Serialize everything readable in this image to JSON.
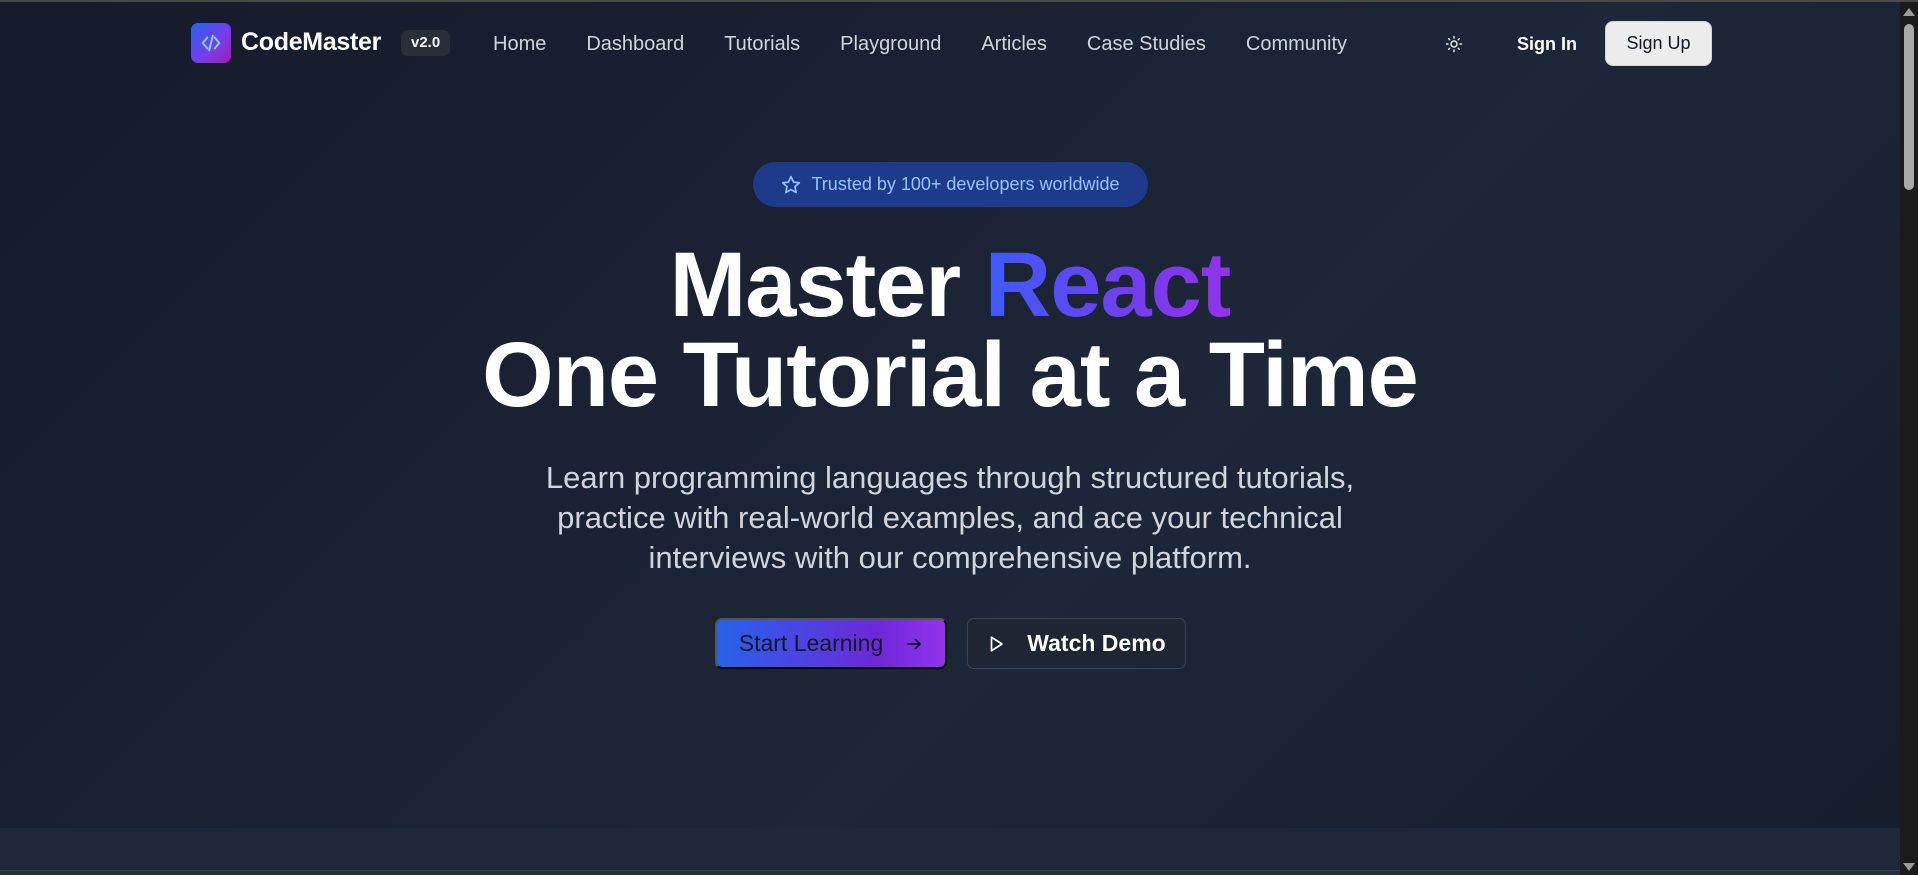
{
  "header": {
    "brand_name": "CodeMaster",
    "version_badge": "v2.0",
    "nav_links": [
      "Home",
      "Dashboard",
      "Tutorials",
      "Playground",
      "Articles",
      "Case Studies",
      "Community"
    ],
    "sign_in_label": "Sign In",
    "sign_up_label": "Sign Up"
  },
  "hero": {
    "trust_badge": "Trusted by 100+ developers worldwide",
    "headline_line1_prefix": "Master",
    "headline_line1_accent": "React",
    "headline_line2": "One Tutorial at a Time",
    "subtitle": "Learn programming languages through structured tutorials, practice with real-world examples, and ace your technical interviews with our comprehensive platform.",
    "start_button_label": "Start Learning",
    "demo_button_label": "Watch Demo"
  },
  "icons": {
    "logo": "code-icon",
    "theme": "sun-icon",
    "badge": "star-icon",
    "start": "arrow-right-icon",
    "demo": "play-icon"
  },
  "colors": {
    "background": "#1a2232",
    "accent_start": "#2563eb",
    "accent_end": "#9333ea",
    "badge_bg": "#1e3a8a",
    "badge_text": "#93c5fd"
  }
}
